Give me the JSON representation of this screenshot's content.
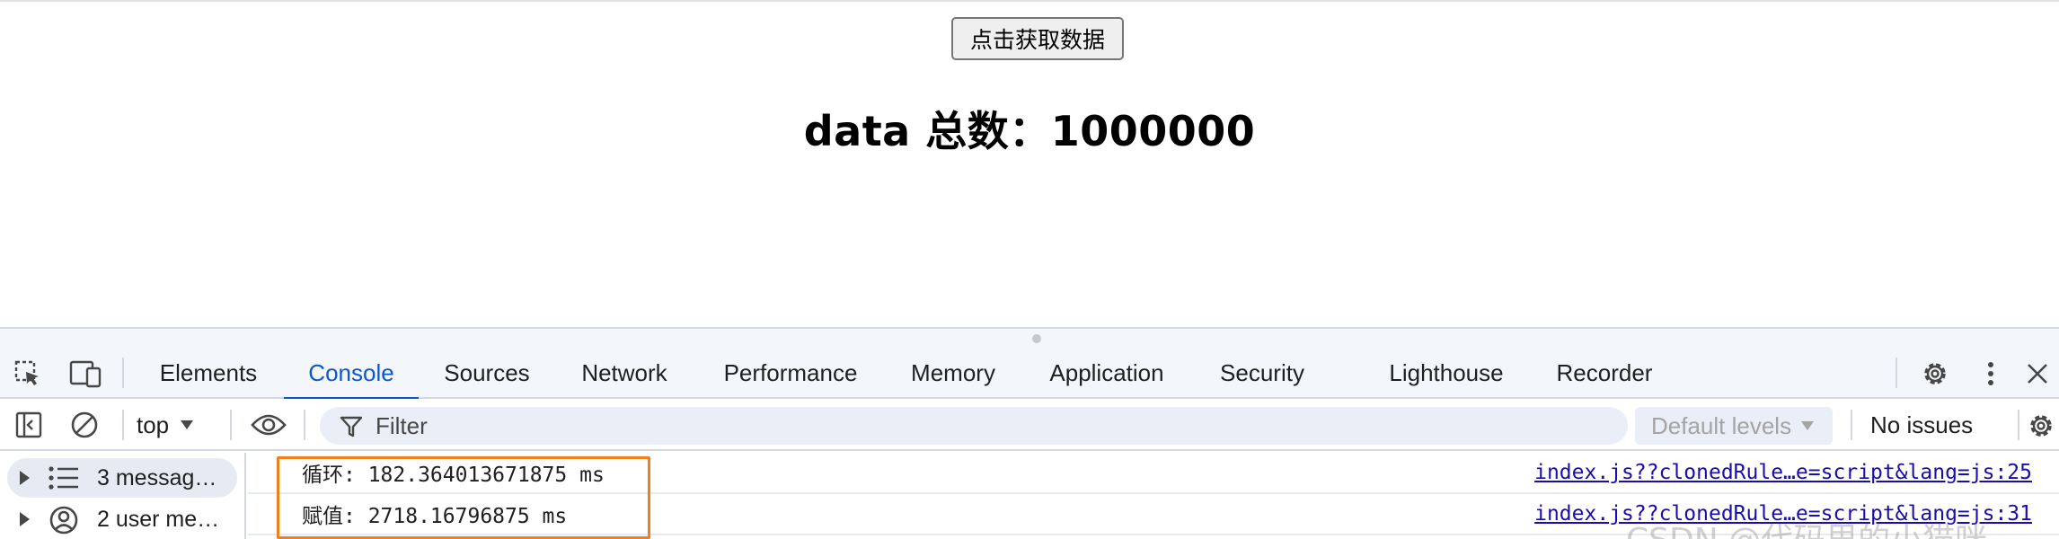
{
  "page": {
    "fetch_button_label": "点击获取数据",
    "heading": "data 总数：1000000"
  },
  "devtools": {
    "tabs": [
      {
        "label": "Elements",
        "active": false
      },
      {
        "label": "Console",
        "active": true
      },
      {
        "label": "Sources",
        "active": false
      },
      {
        "label": "Network",
        "active": false
      },
      {
        "label": "Performance",
        "active": false
      },
      {
        "label": "Memory",
        "active": false
      },
      {
        "label": "Application",
        "active": false
      },
      {
        "label": "Security",
        "active": false
      },
      {
        "label": "Lighthouse",
        "active": false
      },
      {
        "label": "Recorder",
        "active": false
      }
    ],
    "toolbar": {
      "context": "top",
      "filter_placeholder": "Filter",
      "levels_label": "Default levels",
      "issues_label": "No issues"
    },
    "sidebar": {
      "items": [
        {
          "label": "3 messag…",
          "icon": "list-icon"
        },
        {
          "label": "2 user me…",
          "icon": "user-icon"
        }
      ]
    },
    "logs": [
      {
        "message": "循环: 182.364013671875 ms",
        "source": "index.js??clonedRule…e=script&lang=js:25"
      },
      {
        "message": "赋值: 2718.16796875 ms",
        "source": "index.js??clonedRule…e=script&lang=js:31"
      }
    ]
  },
  "watermark": "CSDN @代码里的小猫咪",
  "colors": {
    "accent": "#0b57d0",
    "highlight": "#f0801b",
    "link": "#1a0dab"
  }
}
